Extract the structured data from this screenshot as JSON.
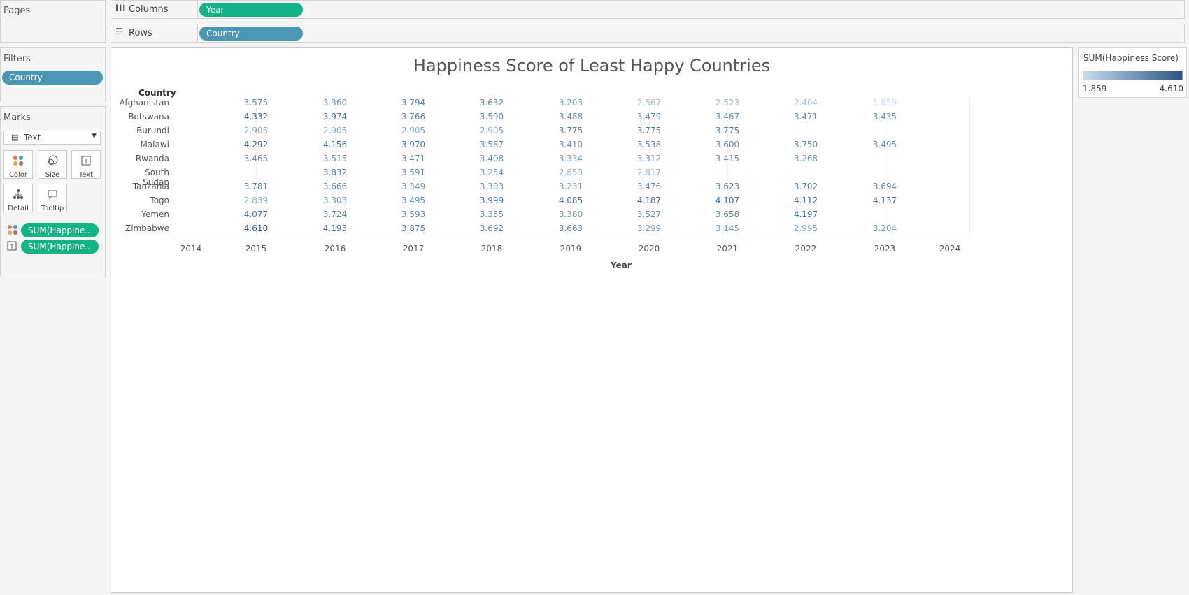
{
  "pages": {
    "title": "Pages"
  },
  "columns_shelf": {
    "label": "Columns",
    "pill": "Year"
  },
  "rows_shelf": {
    "label": "Rows",
    "pill": "Country"
  },
  "filters": {
    "title": "Filters",
    "pill": "Country"
  },
  "marks": {
    "title": "Marks",
    "type": "Text",
    "buttons": [
      {
        "label": "Color",
        "icon": "color-dots-icon"
      },
      {
        "label": "Size",
        "icon": "size-circles-icon"
      },
      {
        "label": "Text",
        "icon": "text-box-icon"
      },
      {
        "label": "Detail",
        "icon": "detail-tree-icon"
      },
      {
        "label": "Tooltip",
        "icon": "tooltip-bubble-icon"
      }
    ],
    "fields": [
      {
        "label": "SUM(Happine..",
        "icon": "color-dots-icon"
      },
      {
        "label": "SUM(Happine..",
        "icon": "text-box-icon"
      }
    ]
  },
  "legend": {
    "title": "SUM(Happiness Score)",
    "min_label": "1.859",
    "max_label": "4.610",
    "color_low": "#c6dbef",
    "color_high": "#2a5783"
  },
  "chart_data": {
    "type": "table",
    "title": "Happiness Score of Least Happy Countries",
    "row_header": "Country",
    "xlabel": "Year",
    "x_ticks": [
      "2014",
      "2015",
      "2016",
      "2017",
      "2018",
      "2019",
      "2020",
      "2021",
      "2022",
      "2023",
      "2024"
    ],
    "years": [
      "2015",
      "2016",
      "2017",
      "2018",
      "2019",
      "2020",
      "2021",
      "2022",
      "2023"
    ],
    "countries": [
      "Afghanistan",
      "Botswana",
      "Burundi",
      "Malawi",
      "Rwanda",
      "South Sudan",
      "Tanzania",
      "Togo",
      "Yemen",
      "Zimbabwe"
    ],
    "values": [
      [
        "3.575",
        "3.360",
        "3.794",
        "3.632",
        "3.203",
        "2.567",
        "2.523",
        "2.404",
        "1.859"
      ],
      [
        "4.332",
        "3.974",
        "3.766",
        "3.590",
        "3.488",
        "3.479",
        "3.467",
        "3.471",
        "3.435"
      ],
      [
        "2.905",
        "2.905",
        "2.905",
        "2.905",
        "3.775",
        "3.775",
        "3.775",
        "",
        ""
      ],
      [
        "4.292",
        "4.156",
        "3.970",
        "3.587",
        "3.410",
        "3.538",
        "3.600",
        "3.750",
        "3.495"
      ],
      [
        "3.465",
        "3.515",
        "3.471",
        "3.408",
        "3.334",
        "3.312",
        "3.415",
        "3.268",
        ""
      ],
      [
        "",
        "3.832",
        "3.591",
        "3.254",
        "2.853",
        "2.817",
        "",
        "",
        ""
      ],
      [
        "3.781",
        "3.666",
        "3.349",
        "3.303",
        "3.231",
        "3.476",
        "3.623",
        "3.702",
        "3.694"
      ],
      [
        "2.839",
        "3.303",
        "3.495",
        "3.999",
        "4.085",
        "4.187",
        "4.107",
        "4.112",
        "4.137"
      ],
      [
        "4.077",
        "3.724",
        "3.593",
        "3.355",
        "3.380",
        "3.527",
        "3.658",
        "4.197",
        ""
      ],
      [
        "4.610",
        "4.193",
        "3.875",
        "3.692",
        "3.663",
        "3.299",
        "3.145",
        "2.995",
        "3.204"
      ]
    ],
    "color_range": [
      1.859,
      4.61
    ]
  }
}
